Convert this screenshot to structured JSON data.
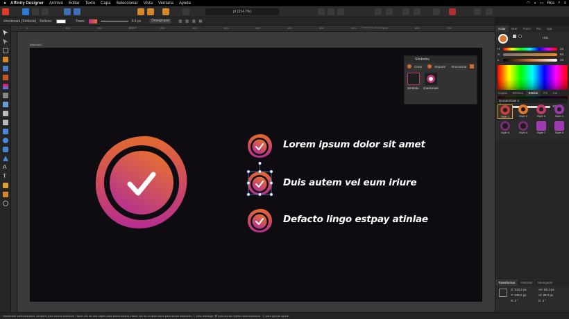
{
  "menubar": {
    "app_name": "Affinity Designer",
    "items": [
      "Archivo",
      "Editar",
      "Texto",
      "Capa",
      "Seleccionar",
      "Vista",
      "Ventana",
      "Ayuda"
    ],
    "user": "Ros"
  },
  "toolbar": {
    "zoom_label": "pt (314.7%)"
  },
  "context_bar": {
    "selection_label": "checkmark (Símbolo)",
    "fill_label": "Relleno:",
    "stroke_label": "Trazo:",
    "stroke_width": "3.6 px",
    "ungroup_button": "Desagrupar"
  },
  "ruler": {
    "ticks": [
      "0",
      "100",
      "150",
      "200",
      "250",
      "300",
      "350",
      "400",
      "450",
      "500",
      "550",
      "600",
      "650",
      "700",
      "750",
      "800",
      "900",
      "950",
      "1000",
      "1050",
      "1100"
    ],
    "top_label_1": "pt (px)",
    "top_label_2": "Símbolos (s) (px)"
  },
  "artboard": {
    "label": "Artboard1"
  },
  "symbols_panel": {
    "title": "Símbolos",
    "buttons": [
      "Crear",
      "Separar",
      "Sincronizar"
    ],
    "items": [
      "Símbolo",
      "checkmark"
    ]
  },
  "features": [
    "Lorem ipsum dolor sit amet",
    "Duis autem vel eum iriure",
    "Defacto lingo estpay atinlae"
  ],
  "right_panel": {
    "top_tabs": [
      "Color",
      "Mue",
      "Trazo",
      "Pin",
      "Apa"
    ],
    "color_model": "HSL",
    "sliders": [
      {
        "label": "H",
        "value": "34"
      },
      {
        "label": "S",
        "value": "83"
      },
      {
        "label": "L",
        "value": "43"
      }
    ],
    "opacity_label": "Opacidad",
    "opacity_value": "100 %",
    "mid_tabs": [
      "Capas",
      "Efectos",
      "Estilos",
      "FX",
      "Ins"
    ],
    "style_category": "Dorado/Glas 2",
    "styles": [
      "Style 1",
      "Style 2",
      "Style 3",
      "Style 4",
      "Style 5",
      "Style 6",
      "Style 7",
      "Style 8"
    ],
    "bottom_tabs": [
      "Transformar",
      "Historial",
      "Navegador"
    ],
    "transform": {
      "x_label": "X:",
      "x_value": "519.2 px",
      "y_label": "Y:",
      "y_value": "349.2 px",
      "w_label": "An:",
      "w_value": "86.3 px",
      "h_label": "Al:",
      "h_value": "86.3 px",
      "r_label": "R:",
      "r_value": "0 °",
      "s_label": "D:",
      "s_value": "0 °"
    }
  },
  "status_bar": {
    "text": "'checkmark' seleccionados. Arrastrar para mover selección. Hacer clic en otro objeto para seleccionarlo. Hacer clic en un área vacía para anular selección. ⇧ para restringir. ⌘ para clonar objetos seleccionados. ⌥ para ignorar ajuste."
  },
  "colors": {
    "accent_orange": "#e36a30",
    "accent_magenta": "#b62d8e",
    "artboard_bg": "#0e0c10"
  }
}
